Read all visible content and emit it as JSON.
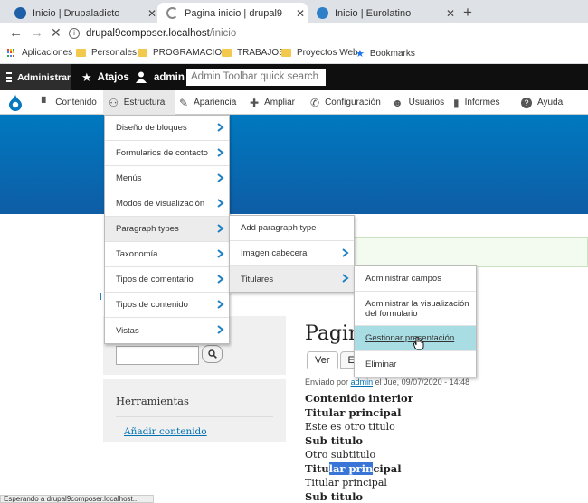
{
  "browser": {
    "tabs": [
      {
        "title": "Inicio | Drupaladicto",
        "active": false,
        "favicon_color": "#1f5fa8"
      },
      {
        "title": "Pagina inicio | drupal9",
        "active": true,
        "favicon_color": "#888888"
      },
      {
        "title": "Inicio | Eurolatino",
        "active": false,
        "favicon_color": "#2d7fc7"
      }
    ],
    "new_tab_symbol": "+",
    "url_host": "drupal9composer.localhost",
    "url_path": "/inicio",
    "bookmarks": [
      "Aplicaciones",
      "Personales",
      "PROGRAMACION",
      "TRABAJOS",
      "Proyectos Web",
      "Bookmarks"
    ]
  },
  "toolbar": {
    "manage": "Administrar",
    "shortcuts": "Atajos",
    "user": "admin",
    "search_placeholder": "Admin Toolbar quick search"
  },
  "tray": {
    "items": [
      "Contenido",
      "Estructura",
      "Apariencia",
      "Ampliar",
      "Configuración",
      "Usuarios",
      "Informes",
      "Ayuda"
    ]
  },
  "menus": {
    "estructura": [
      "Diseño de bloques",
      "Formularios de contacto",
      "Menús",
      "Modos de visualización",
      "Paragraph types",
      "Taxonomía",
      "Tipos de comentario",
      "Tipos de contenido",
      "Vistas"
    ],
    "paragraph_types": [
      "Add paragraph type",
      "Imagen cabecera",
      "Titulares"
    ],
    "titulares": [
      "Administrar campos",
      "Administrar la visualización del formulario",
      "Gestionar presentación",
      "Eliminar"
    ]
  },
  "page": {
    "left_fragment": "I",
    "node_title": "Pagina",
    "tabs": [
      "Ver",
      "Ed"
    ],
    "submitted_prefix": "Enviado por",
    "submitted_user": "admin",
    "submitted_suffix": "el Jue, 09/07/2020 - 14:48",
    "content": [
      {
        "text": "Contenido interior",
        "bold": true
      },
      {
        "text": "Titular principal",
        "bold": true
      },
      {
        "text": "Este es otro titulo",
        "bold": false
      },
      {
        "text": "Sub titulo",
        "bold": true
      },
      {
        "text": "Otro subtitulo",
        "bold": false
      }
    ],
    "selected_line": {
      "before": "Titu",
      "selected": "lar prin",
      "after": "cipal"
    },
    "after_selection": [
      {
        "text": "Titular principal",
        "bold": false
      },
      {
        "text": "Sub titulo",
        "bold": true
      }
    ],
    "tools_title": "Herramientas",
    "tools_link": "Añadir contenido"
  },
  "statusbar": "Esperando a drupal9composer.localhost..."
}
